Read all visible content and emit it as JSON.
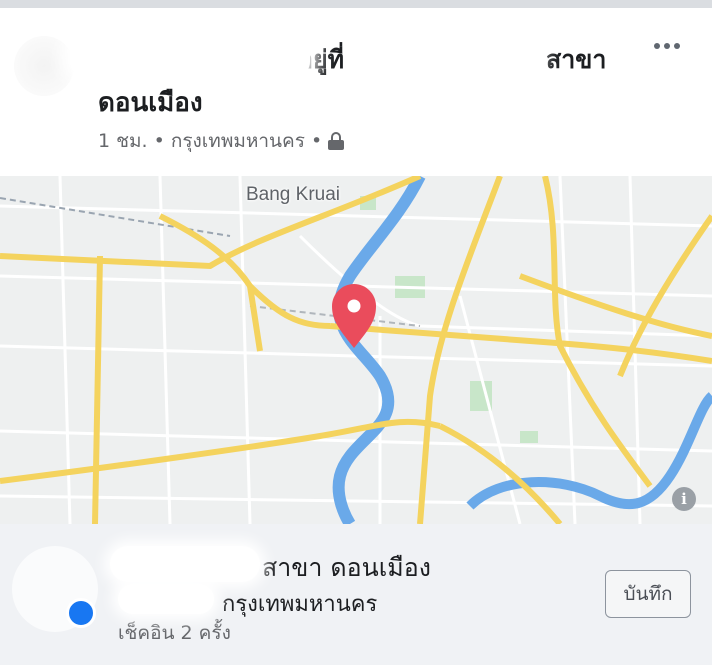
{
  "post": {
    "header_prefix": "อยู่ที่",
    "header_branch": "สาขา",
    "branch_name": "ดอนเมือง",
    "time": "1 ชม.",
    "separator": "•",
    "location": "กรุงเทพมหานคร",
    "privacy_icon": "lock-icon",
    "more_icon": "more-horizontal-icon"
  },
  "map": {
    "place_label": "Bang Kruai",
    "pin_icon": "map-pin-icon",
    "info_icon_label": "i",
    "colors": {
      "background": "#eef0f0",
      "major_road": "#f4d35e",
      "minor_road": "#ffffff",
      "river": "#6aa9e9",
      "park": "#c8e6c9",
      "pin": "#ea4c5c"
    }
  },
  "checkin": {
    "title_suffix": "สาขา ดอนเมือง",
    "subtitle_suffix": "กรุงเทพมหานคร",
    "count_text": "เช็คอิน 2 ครั้ง",
    "save_label": "บันทึก"
  },
  "colors": {
    "accent_blue": "#1877f2",
    "secondary_text": "#65676b",
    "bar_background": "#f0f2f5"
  }
}
